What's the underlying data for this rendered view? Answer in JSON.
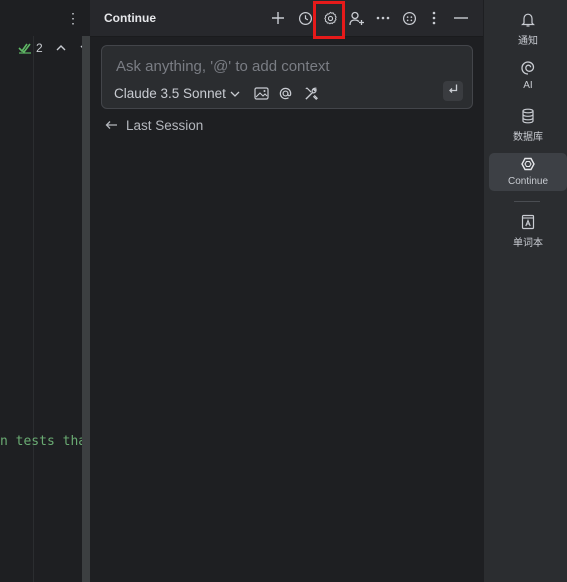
{
  "editor": {
    "inspection_count": "2",
    "code_fragment": "n tests that"
  },
  "panel": {
    "title": "Continue",
    "header_icons": [
      "plus-icon",
      "history-icon",
      "gear-icon",
      "add-user-icon",
      "more-horizontal-icon",
      "emoji-icon",
      "kebab-icon",
      "minimize-icon"
    ],
    "input": {
      "value": "",
      "placeholder": "Ask anything, '@' to add context"
    },
    "model": "Claude 3.5 Sonnet",
    "last_session_label": "Last Session"
  },
  "tool_strip": {
    "items": [
      {
        "label": "通知",
        "icon": "bell-icon",
        "active": false
      },
      {
        "label": "AI",
        "icon": "ai-swirl-icon",
        "active": false
      },
      {
        "label": "数据库",
        "icon": "database-icon",
        "active": false
      },
      {
        "label": "Continue",
        "icon": "continue-icon",
        "active": true
      },
      {
        "label": "单词本",
        "icon": "wordbook-icon",
        "active": false
      }
    ]
  },
  "colors": {
    "background": "#1e1f22",
    "header": "#27282c",
    "strip": "#2b2d30",
    "highlight": "#e61a1a",
    "code_green": "#6aab73"
  }
}
